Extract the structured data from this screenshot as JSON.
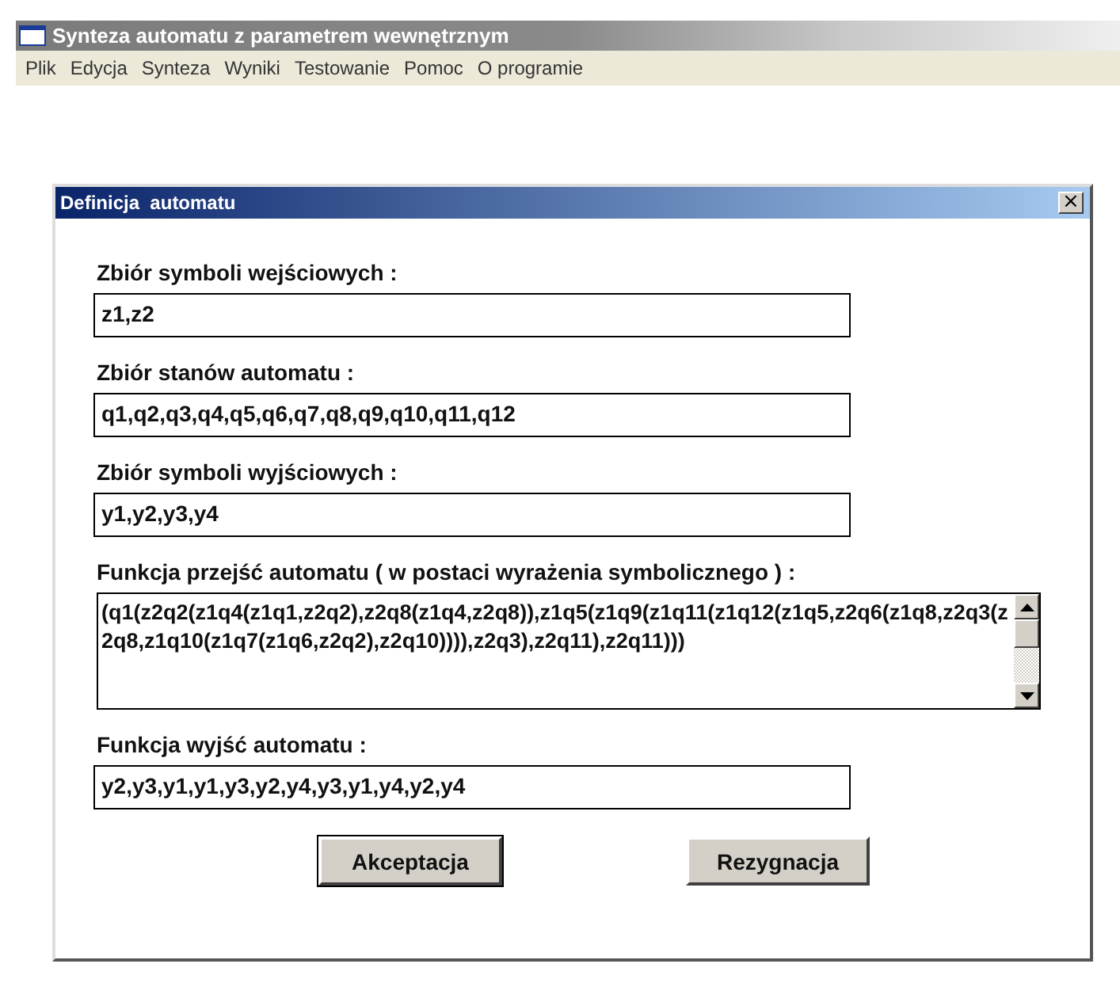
{
  "window": {
    "title": "Synteza automatu z parametrem wewnętrznym"
  },
  "menu": [
    "Plik",
    "Edycja",
    "Synteza",
    "Wyniki",
    "Testowanie",
    "Pomoc",
    "O programie"
  ],
  "dialog": {
    "title": "Definicja  automatu",
    "close": "×",
    "fields": [
      {
        "kind": "line",
        "label": "Zbiór symboli wejściowych :",
        "value": "z1,z2"
      },
      {
        "kind": "line",
        "label": "Zbiór stanów automatu :",
        "value": "q1,q2,q3,q4,q5,q6,q7,q8,q9,q10,q11,q12"
      },
      {
        "kind": "line",
        "label": "Zbiór symboli wyjściowych :",
        "value": "y1,y2,y3,y4"
      },
      {
        "kind": "memo",
        "label": "Funkcja przejść automatu ( w postaci wyrażenia symbolicznego ) :",
        "value": "(q1(z2q2(z1q4(z1q1,z2q2),z2q8(z1q4,z2q8)),z1q5(z1q9(z1q11(z1q12(z1q5,z2q6(z1q8,z2q3(z2q8,z1q10(z1q7(z1q6,z2q2),z2q10)))),z2q3),z2q11),z2q11)))"
      },
      {
        "kind": "line",
        "label": "Funkcja wyjść automatu :",
        "value": "y2,y3,y1,y1,y3,y2,y4,y3,y1,y4,y2,y4"
      }
    ],
    "buttons": [
      "Akceptacja",
      "Rezygnacja"
    ]
  }
}
